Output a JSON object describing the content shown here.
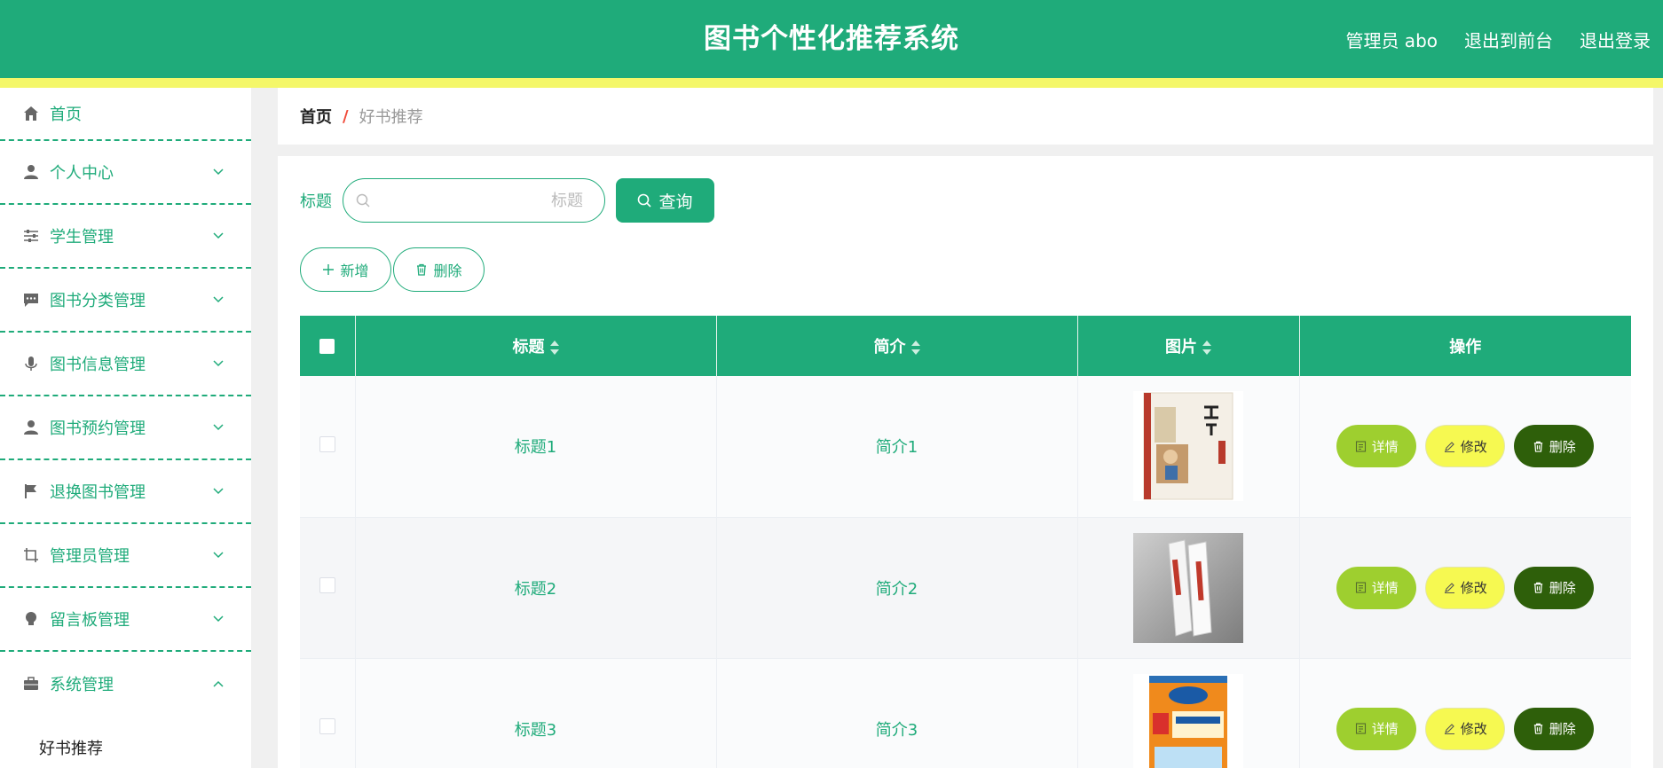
{
  "header": {
    "title": "图书个性化推荐系统",
    "admin_label": "管理员 abo",
    "to_front_label": "退出到前台",
    "logout_label": "退出登录"
  },
  "sidebar": {
    "items": [
      {
        "label": "首页",
        "icon": "home-icon"
      },
      {
        "label": "个人中心",
        "icon": "user-icon"
      },
      {
        "label": "学生管理",
        "icon": "sliders-icon"
      },
      {
        "label": "图书分类管理",
        "icon": "chat-icon"
      },
      {
        "label": "图书信息管理",
        "icon": "microphone-icon"
      },
      {
        "label": "图书预约管理",
        "icon": "user-icon"
      },
      {
        "label": "退换图书管理",
        "icon": "flag-icon"
      },
      {
        "label": "管理员管理",
        "icon": "crop-icon"
      },
      {
        "label": "留言板管理",
        "icon": "bulb-icon"
      },
      {
        "label": "系统管理",
        "icon": "briefcase-icon"
      }
    ],
    "submenu_label": "好书推荐"
  },
  "breadcrumb": {
    "home": "首页",
    "separator": "/",
    "current": "好书推荐"
  },
  "search": {
    "label": "标题",
    "placeholder": "标题",
    "button_label": "查询"
  },
  "actions": {
    "add_label": "新增",
    "delete_label": "删除"
  },
  "table": {
    "columns": [
      "标题",
      "简介",
      "图片",
      "操作"
    ],
    "rows": [
      {
        "title": "标题1",
        "intro": "简介1",
        "image": "book-cover-dizigui"
      },
      {
        "title": "标题2",
        "intro": "简介2",
        "image": "book-cover-grey"
      },
      {
        "title": "标题3",
        "intro": "简介3",
        "image": "book-cover-orange"
      }
    ],
    "detail_label": "详情",
    "edit_label": "修改",
    "delete_label": "删除"
  },
  "colors": {
    "primary": "#1fab7a",
    "stripe": "#f4f769",
    "detail": "#9ecf2f",
    "edit": "#f6f951",
    "delete": "#2e5f0a"
  }
}
